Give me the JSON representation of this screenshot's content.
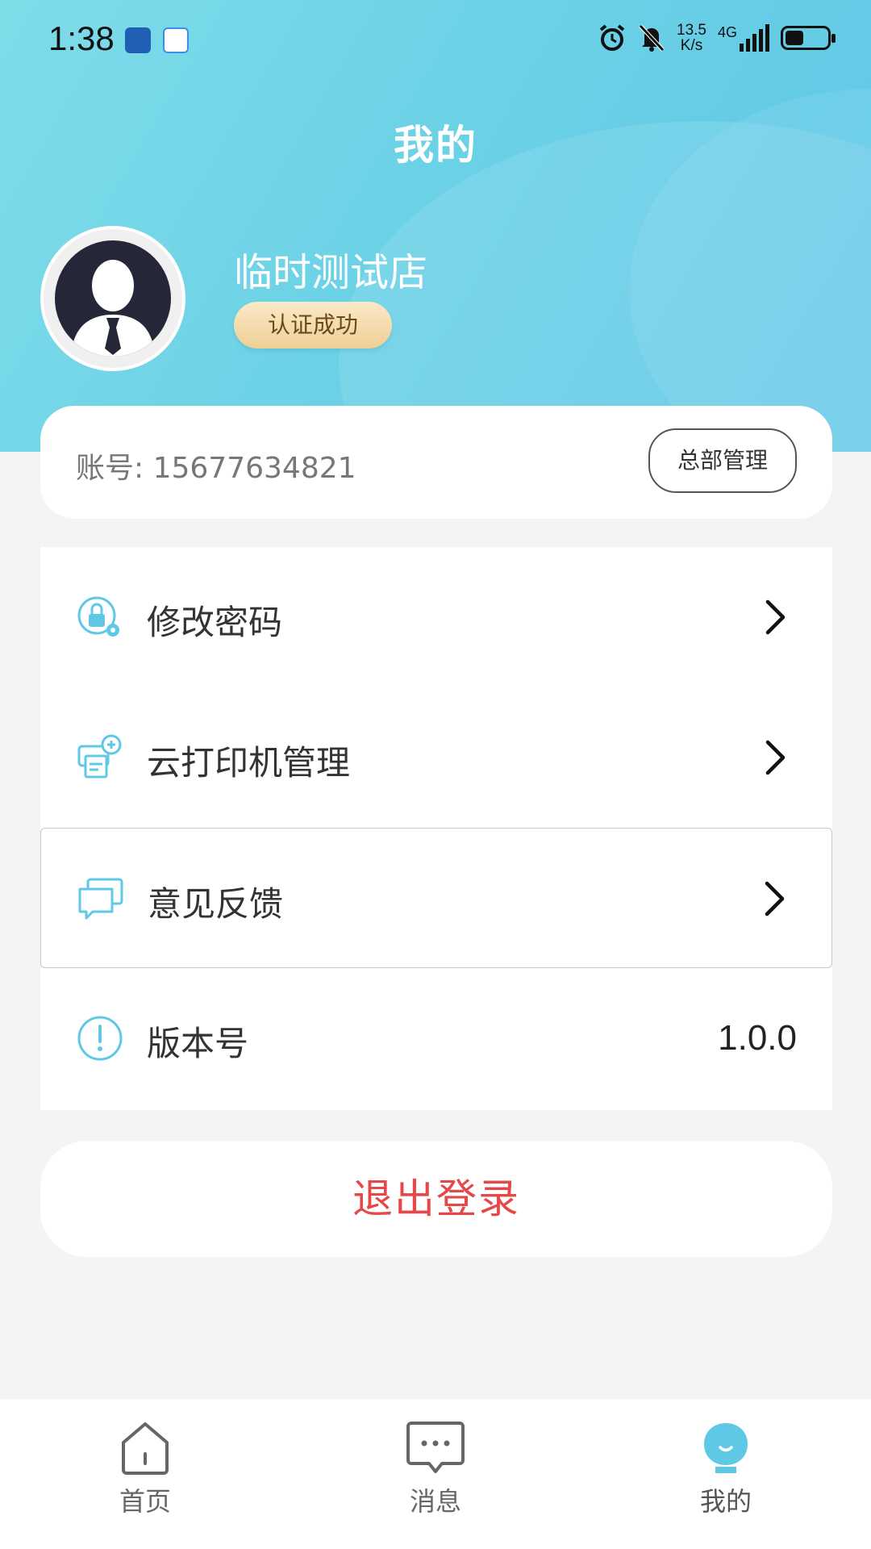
{
  "status_bar": {
    "time": "1:38",
    "net_speed_top": "13.5",
    "net_speed_bottom": "K/s",
    "network": "4G"
  },
  "header": {
    "title": "我的"
  },
  "profile": {
    "store_name": "临时测试店",
    "cert_badge": "认证成功"
  },
  "account": {
    "label": "账号:",
    "value": "15677634821",
    "hq_button": "总部管理"
  },
  "menu": {
    "change_password": "修改密码",
    "printer_manage": "云打印机管理",
    "feedback": "意见反馈",
    "version_label": "版本号",
    "version_value": "1.0.0"
  },
  "logout": {
    "label": "退出登录"
  },
  "tabs": {
    "home": "首页",
    "messages": "消息",
    "mine": "我的"
  },
  "colors": {
    "accent": "#5fc8e4",
    "logout": "#e44848",
    "header_gradient_start": "#7fdce9",
    "header_gradient_end": "#5fc6e7"
  }
}
